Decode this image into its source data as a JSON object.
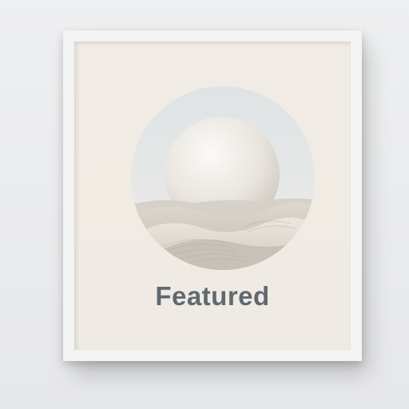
{
  "frame": {
    "caption": "Featured"
  },
  "artwork": {
    "subject": "sphere-over-sand-dunes-icon"
  }
}
